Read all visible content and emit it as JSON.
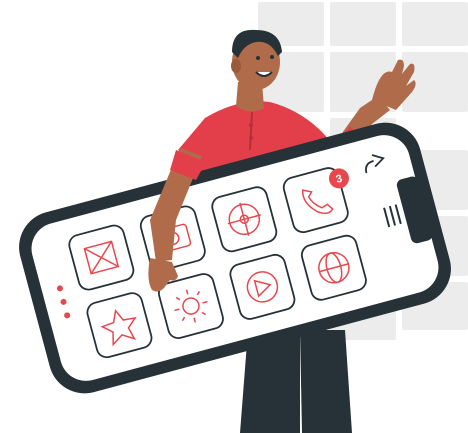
{
  "illustration": {
    "subject": "person-carrying-phone",
    "notification_badge": {
      "count": "3"
    },
    "app_icons": [
      {
        "name": "mail-icon"
      },
      {
        "name": "camera-icon"
      },
      {
        "name": "compass-icon"
      },
      {
        "name": "phone-icon"
      },
      {
        "name": "star-icon"
      },
      {
        "name": "sun-icon"
      },
      {
        "name": "play-icon"
      },
      {
        "name": "globe-icon"
      }
    ],
    "colors": {
      "accent": "#E8474E",
      "phone_frame": "#263238",
      "skin": "#B06B4B",
      "shirt": "#E23F4A",
      "background_grid": "#EBEBEB"
    }
  }
}
